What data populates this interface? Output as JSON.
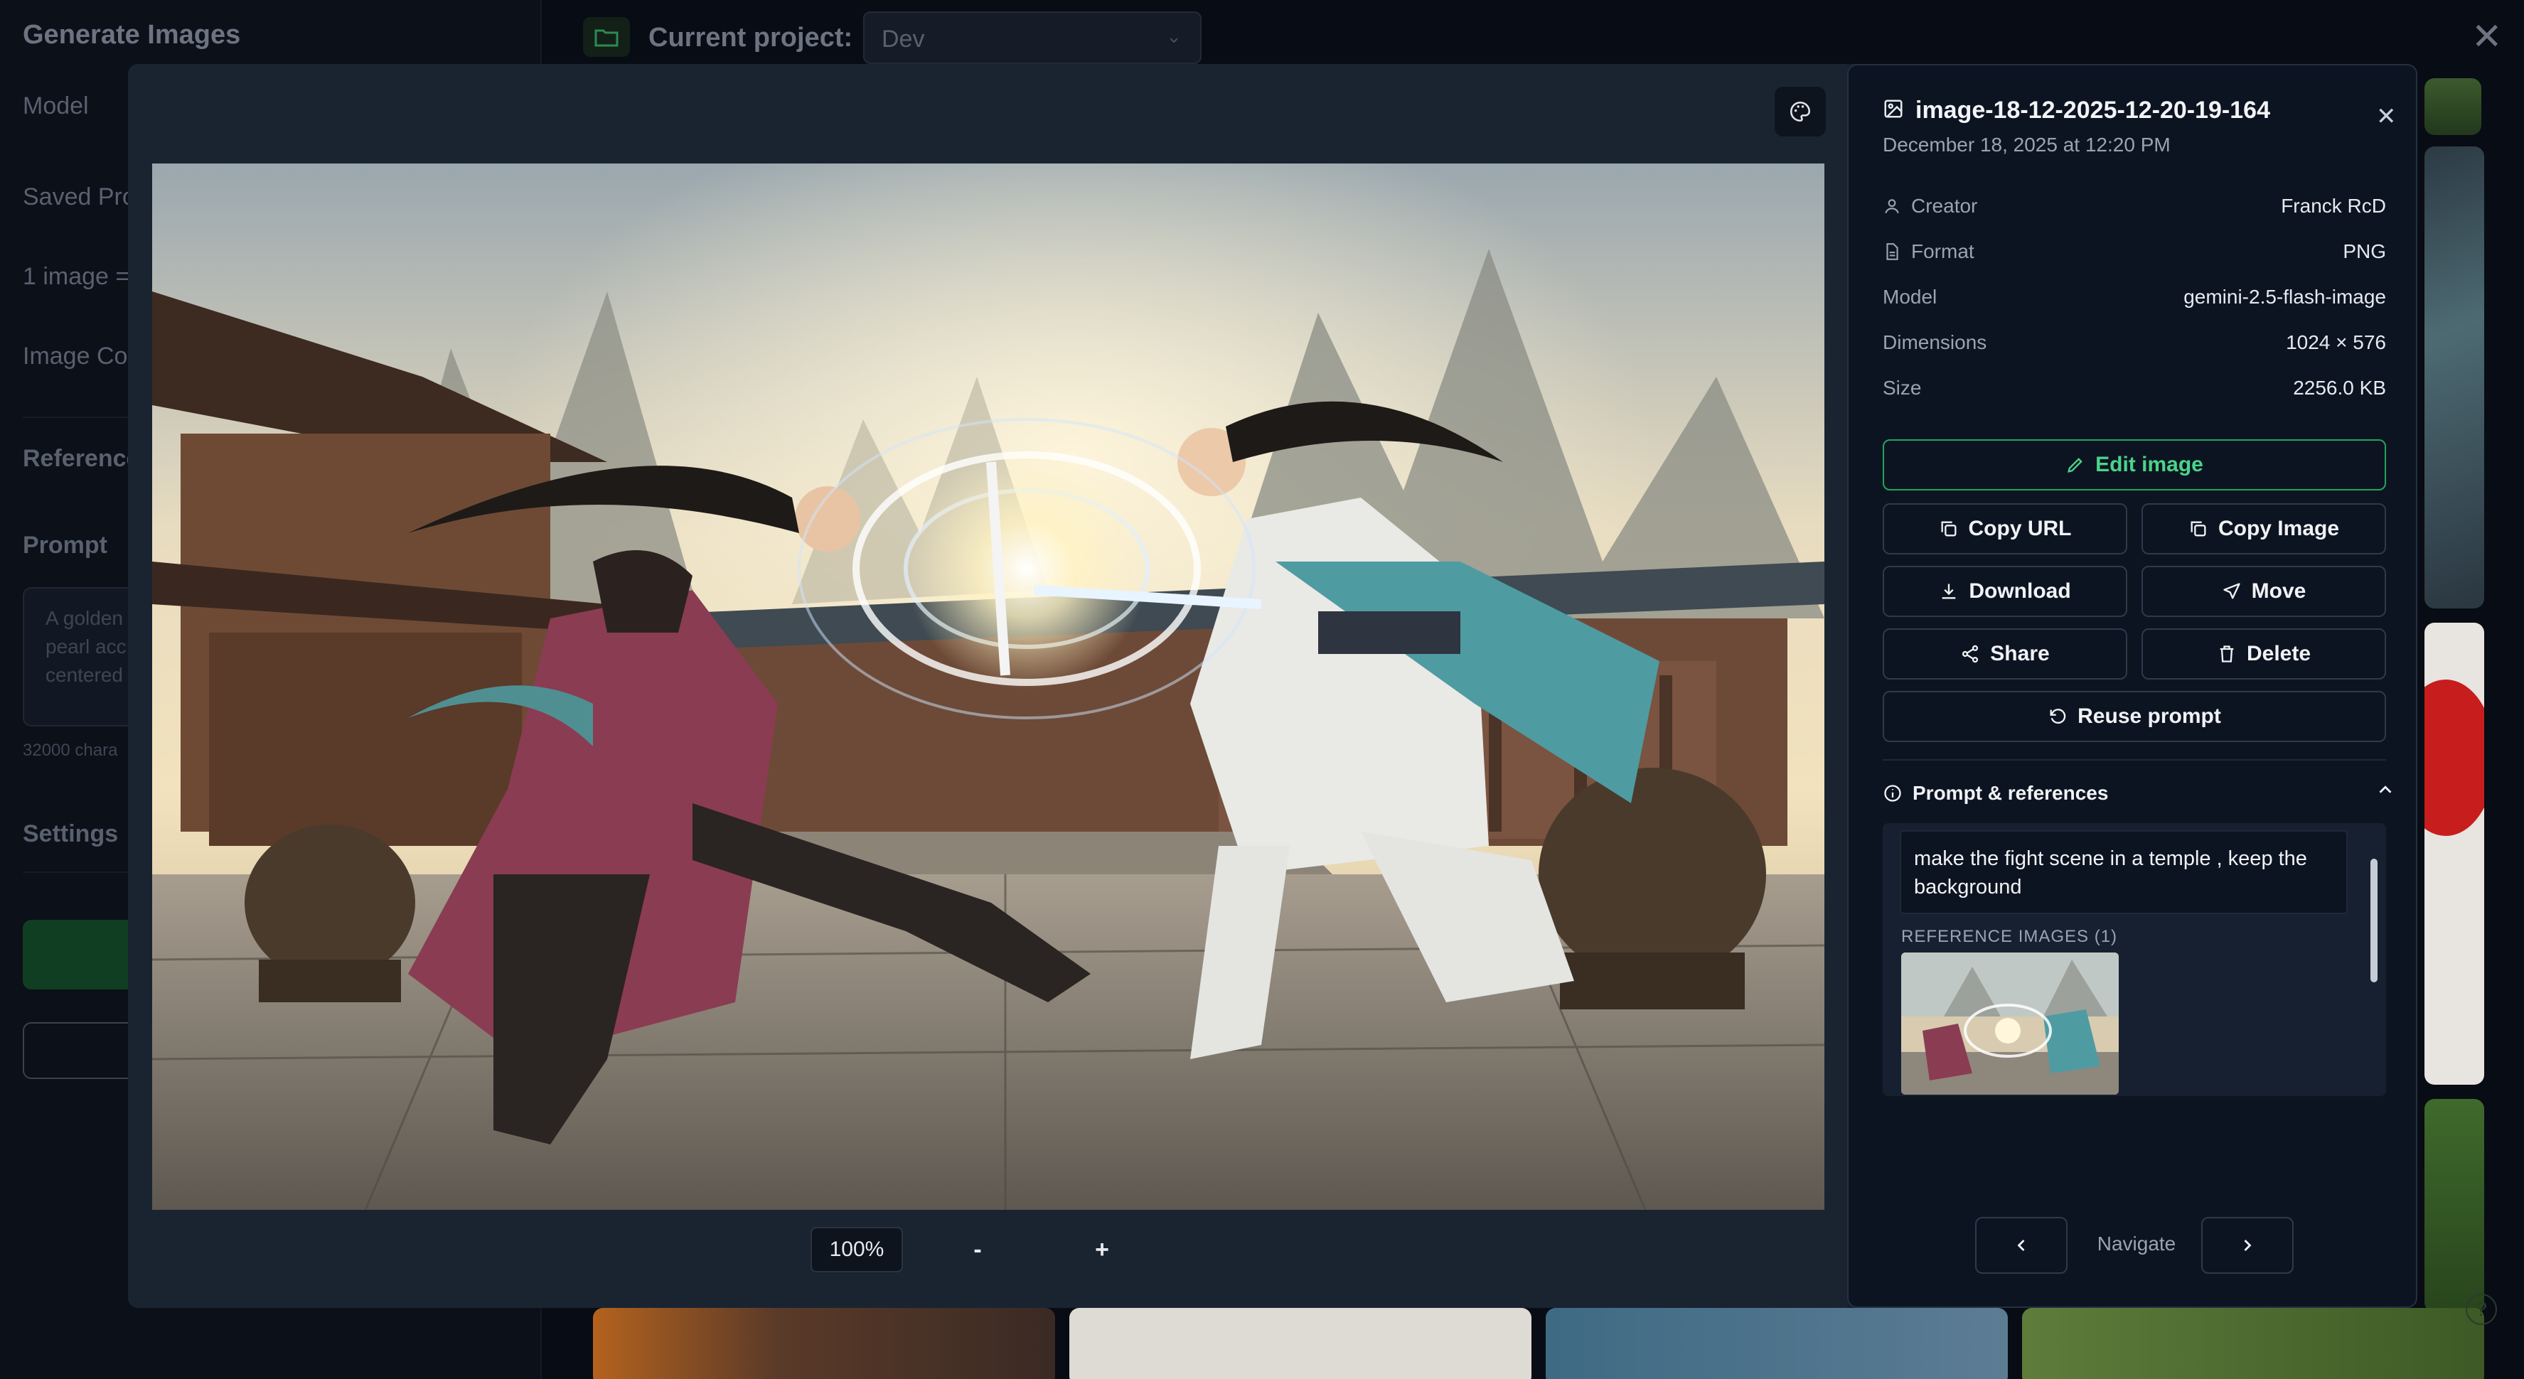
{
  "background": {
    "sidebar_title": "Generate Images",
    "labels": {
      "model": "Model",
      "saved_prompts": "Saved Pro",
      "image_cost": "1 image =",
      "image_count": "Image Co",
      "references": "Reference",
      "prompt": "Prompt",
      "settings": "Settings"
    },
    "prompt_placeholder": "A golden pearl acc centered",
    "char_limit": "32000 chara",
    "project_label": "Current project:",
    "project_value": "Dev"
  },
  "viewer": {
    "zoom": "100%",
    "zoom_out": "-",
    "zoom_in": "+"
  },
  "details": {
    "title": "image-18-12-2025-12-20-19-164",
    "date": "December 18, 2025 at 12:20 PM",
    "meta": [
      {
        "key": "Creator",
        "value": "Franck RcD",
        "icon": "user-icon"
      },
      {
        "key": "Format",
        "value": "PNG",
        "icon": "file-icon"
      },
      {
        "key": "Model",
        "value": "gemini-2.5-flash-image",
        "icon": ""
      },
      {
        "key": "Dimensions",
        "value": "1024 × 576",
        "icon": ""
      },
      {
        "key": "Size",
        "value": "2256.0 KB",
        "icon": ""
      }
    ],
    "buttons": {
      "edit": "Edit image",
      "copy_url": "Copy URL",
      "copy_image": "Copy Image",
      "download": "Download",
      "move": "Move",
      "share": "Share",
      "delete": "Delete",
      "reuse": "Reuse prompt"
    },
    "prompt_section": {
      "title": "Prompt & references",
      "prompt_text": "make the fight scene in a temple , keep the background",
      "refs_label": "REFERENCE IMAGES (1)"
    },
    "navigate_label": "Navigate"
  },
  "colors": {
    "accent_green": "#22a55a",
    "panel_bg": "#0d1421",
    "modal_bg": "#17202d"
  }
}
